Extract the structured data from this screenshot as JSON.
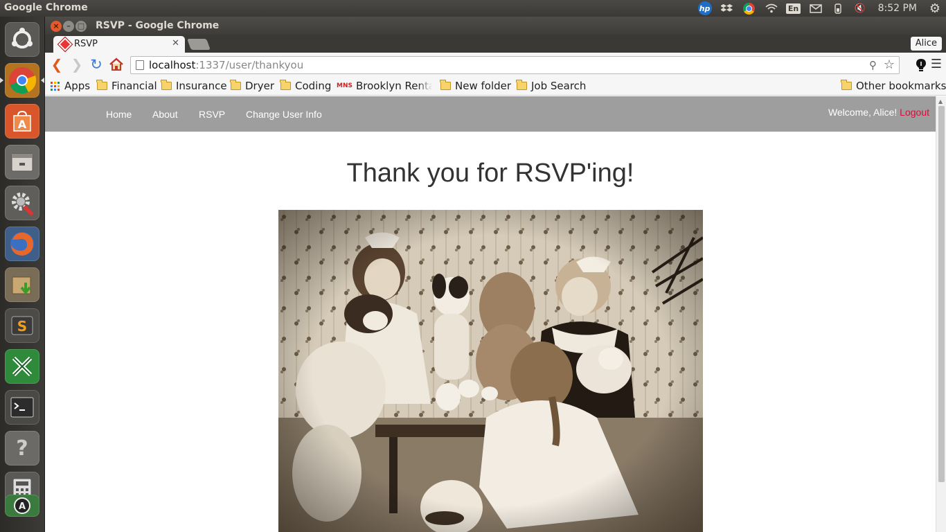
{
  "top_panel": {
    "app_name": "Google Chrome",
    "keyboard_layout": "En",
    "clock": "8:52 PM"
  },
  "launcher": {
    "items": [
      "ubuntu-dash-icon",
      "chrome-icon",
      "software-center-icon",
      "files-icon",
      "system-settings-icon",
      "firefox-icon",
      "archive-manager-icon",
      "sublime-text-icon",
      "xmind-icon",
      "terminal-icon",
      "help-icon",
      "calculator-icon",
      "update-icon"
    ]
  },
  "window": {
    "title": "RSVP - Google Chrome",
    "tab_title": "RSVP",
    "profile": "Alice",
    "url_host": "localhost",
    "url_rest": ":1337/user/thankyou"
  },
  "bookmarks": {
    "apps": "Apps",
    "items": [
      "Financial",
      "Insurance",
      "Dryer",
      "Coding",
      "Brooklyn Rental",
      "New folder",
      "Job Search"
    ],
    "other": "Other bookmarks",
    "mns_badge": "MNS"
  },
  "site": {
    "nav": [
      "Home",
      "About",
      "RSVP",
      "Change User Info"
    ],
    "welcome": "Welcome, Alice!",
    "logout": "Logout",
    "heading": "Thank you for RSVP'ing!"
  },
  "colors": {
    "nav_bg": "#9e9e9e",
    "logout": "#d0103a"
  }
}
